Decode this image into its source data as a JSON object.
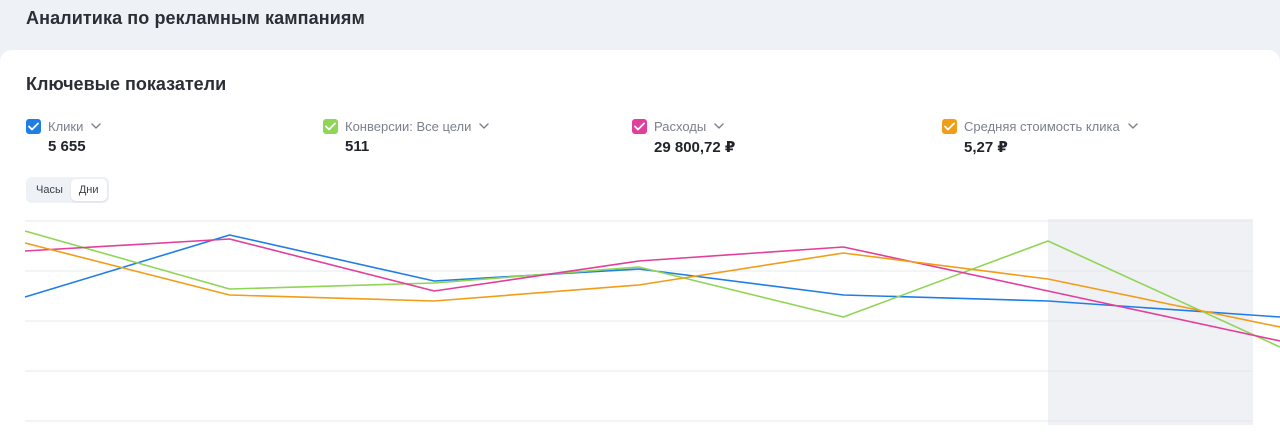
{
  "page": {
    "title": "Аналитика по рекламным кампаниям"
  },
  "card": {
    "title": "Ключевые показатели"
  },
  "metrics": [
    {
      "label": "Клики",
      "value": "5 655",
      "color": "#1f7ee6"
    },
    {
      "label": "Конверсии: Все цели",
      "value": "511",
      "color": "#8fd556"
    },
    {
      "label": "Расходы",
      "value": "29 800,72 ₽",
      "color": "#e23e9b"
    },
    {
      "label": "Средняя стоимость клика",
      "value": "5,27 ₽",
      "color": "#f29d17"
    }
  ],
  "period_toggle": {
    "options": [
      "Часы",
      "Дни"
    ],
    "selected": "Дни"
  },
  "colors": {
    "page_bg": "#eef1f5",
    "card_bg": "#ffffff",
    "grid": "#e6e8ee",
    "highlight": "#eff1f5"
  },
  "chart_data": {
    "type": "line",
    "grid": true,
    "legend": "top",
    "y_scale": "normalized per series, no printed ticks",
    "x_points": 7,
    "highlight_last_interval": true,
    "series": [
      {
        "name": "Клики",
        "color": "#1f7ee6",
        "values": [
          0.62,
          0.93,
          0.7,
          0.76,
          0.63,
          0.6,
          0.52
        ]
      },
      {
        "name": "Конверсии: Все цели",
        "color": "#8fd556",
        "values": [
          0.95,
          0.66,
          0.69,
          0.77,
          0.52,
          0.9,
          0.37
        ]
      },
      {
        "name": "Расходы",
        "color": "#e23e9b",
        "values": [
          0.85,
          0.91,
          0.65,
          0.8,
          0.87,
          0.65,
          0.4
        ]
      },
      {
        "name": "Средняя стоимость клика",
        "color": "#f29d17",
        "values": [
          0.89,
          0.63,
          0.6,
          0.68,
          0.84,
          0.71,
          0.47
        ]
      }
    ]
  }
}
